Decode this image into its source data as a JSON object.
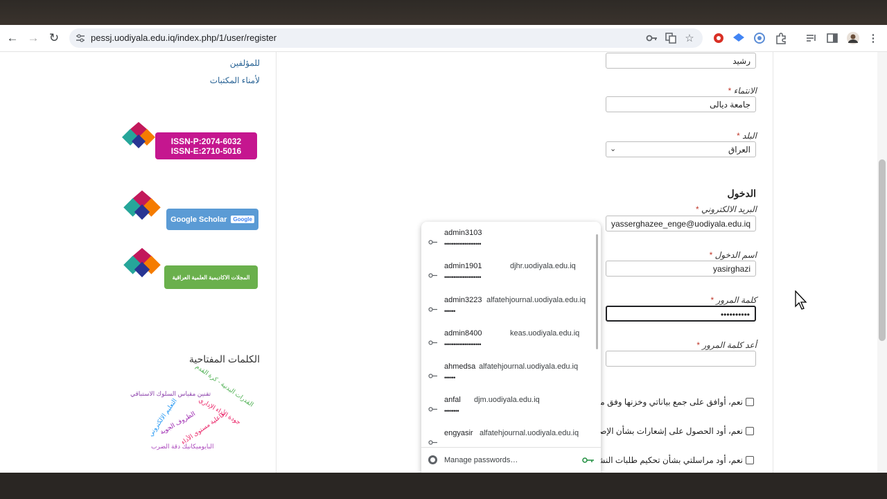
{
  "browser": {
    "url": "pessj.uodiyala.edu.iq/index.php/1/user/register",
    "back_icon": "←",
    "forward_icon": "→",
    "reload_icon": "↻"
  },
  "sidebar": {
    "links": [
      "للمؤلفين",
      "لأمناء المكتبات"
    ],
    "issn_p": "ISSN-P:2074-6032",
    "issn_e": "ISSN-E:2710-5016",
    "scholar_label": "Google Scholar",
    "scholar_logo": "Google",
    "academic_label": "المجلات الاكاديمية العلمية العراقية",
    "keywords_title": "الكلمات المفتاحية",
    "keywords": [
      "القدرات البدنية - كرة القدم",
      "تقنين مقياس السلوك الاستباقي",
      "جودة الأداء الإداري",
      "التعليم الالكتروني",
      "الظروف الجوية",
      "فاعلية مستوى الأداء",
      "البايوميكانيك دقة الضرب"
    ]
  },
  "form": {
    "last_name_value": "رشيد",
    "affiliation_label": "الانتماء",
    "affiliation_value": "جامعة ديالى",
    "country_label": "البلد",
    "country_value": "العراق",
    "login_section": "الدخول",
    "email_label": "البريد الالكتروني",
    "email_value": "yasserghazee_enge@uodiyala.edu.iq",
    "username_label": "اسم الدخول",
    "username_value": "yasirghazi",
    "password_label": "كلمة المرور",
    "password_value": "••••••••••",
    "repeat_password_label": "أعد كلمة المرور",
    "required_mark": "*",
    "consents": [
      "نعم، أوافق على جمع بياناتي وخزنها وفق ما و",
      "نعم، أود الحصول على إشعارات بشأن الإصدا",
      "نعم، أود مراسلتي بشأن تحكيم طلبات النشر ا"
    ]
  },
  "password_popup": {
    "items": [
      {
        "user": "admin3103",
        "site": "",
        "dots": "••••••••••••••••••••"
      },
      {
        "user": "admin1901",
        "site": "djhr.uodiyala.edu.iq",
        "dots": "••••••••••••••••••••"
      },
      {
        "user": "admin3223",
        "site": "alfatehjournal.uodiyala.edu.iq",
        "dots": "••••••"
      },
      {
        "user": "admin8400",
        "site": "keas.uodiyala.edu.iq",
        "dots": "••••••••••••••••••••"
      },
      {
        "user": "ahmedsa",
        "site": "alfatehjournal.uodiyala.edu.iq",
        "dots": "••••••"
      },
      {
        "user": "anfal",
        "site": "djm.uodiyala.edu.iq",
        "dots": "••••••••"
      },
      {
        "user": "engyasir",
        "site": "alfatehjournal.uodiyala.edu.iq",
        "dots": ""
      }
    ],
    "manage_label": "Manage passwords…"
  },
  "colors": {
    "link": "#2a6496",
    "required": "#c0392b",
    "issn_badge": "#c5168f",
    "scholar_badge": "#5b9bd5",
    "academic_badge": "#6ab04c"
  }
}
